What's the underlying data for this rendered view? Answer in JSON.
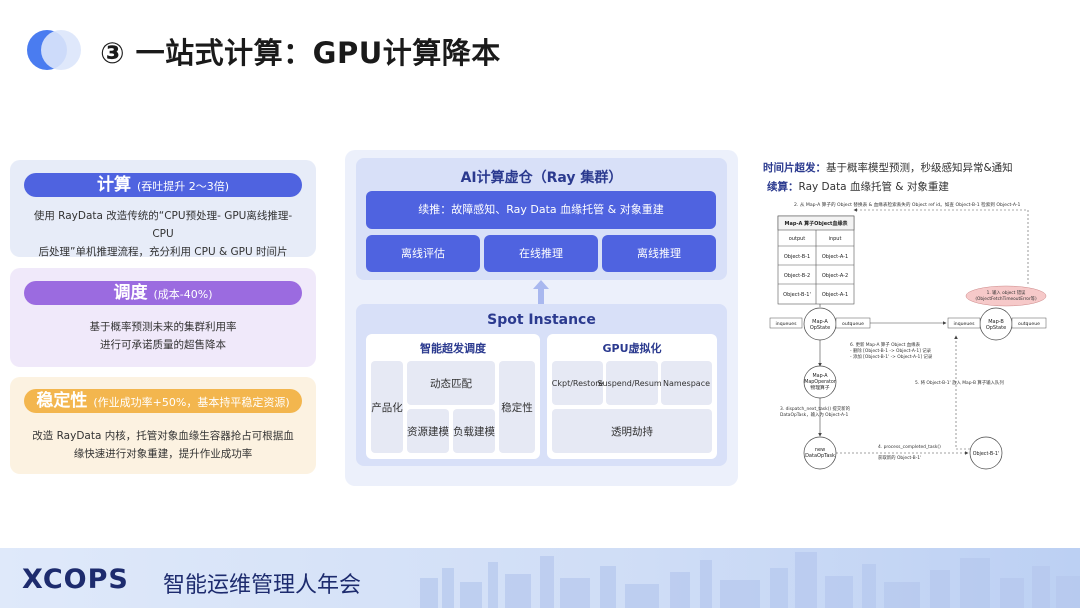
{
  "title": "③ 一站式计算：GPU计算降本",
  "left_cards": {
    "calc": {
      "title": "计算",
      "subtitle": "(吞吐提升 2～3倍)",
      "desc_line1": "使用 RayData 改造传统的“CPU预处理- GPU离线推理-CPU",
      "desc_line2": "后处理”单机推理流程，充分利用 CPU & GPU 时间片"
    },
    "sched": {
      "title": "调度",
      "subtitle": "(成本-40%)",
      "desc_line1": "基于概率预测未来的集群利用率",
      "desc_line2": "进行可承诺质量的超售降本"
    },
    "stab": {
      "title": "稳定性",
      "subtitle": "(作业成功率+50%，基本持平稳定资源)",
      "desc_line1": "改造 RayData 内核，托管对象血缘生容器抢占可根据血",
      "desc_line2": "缘快速进行对象重建，提升作业成功率"
    }
  },
  "ai_box": {
    "title": "AI计算虚仓（Ray 集群）",
    "continuation": "续推：故障感知、Ray Data 血缘托管 & 对象重建",
    "subs": [
      "离线评估",
      "在线推理",
      "离线推理"
    ]
  },
  "spot": {
    "title": "Spot Instance",
    "sched_title": "智能超发调度",
    "productize": "产品化",
    "dynamic_match": "动态匹配",
    "stability": "稳定性",
    "resource_model": "资源建模",
    "load_model": "负载建模",
    "gpu_title": "GPU虚拟化",
    "ckpt": "Ckpt/Restore",
    "suspend": "Suspend/Resume",
    "namespace": "Namespace",
    "transparent": "透明劫持"
  },
  "right": {
    "line1_label": "时间片超发：",
    "line1_text": "基于概率模型预测，秒级感知异常&通知",
    "line2_label": "续算：",
    "line2_text": "Ray Data 血缘托管 & 对象重建",
    "diagram": {
      "step2": "2. 从 Map-A 算子的 Object 替换表 & 血缘表检索丢失的 Object ref id。如查 Object-B-1 检索到 Object-A-1",
      "table_title": "Map-A 算子Object血缘表",
      "col_output": "output",
      "col_input": "input",
      "rows": [
        [
          "Object-B-1",
          "Object-A-1"
        ],
        [
          "Object-B-2",
          "Object-A-2"
        ],
        [
          "Object-B-1'",
          "Object-A-1"
        ]
      ],
      "step1_a": "1. 输入 object 错误",
      "step1_b": "(ObjectFetchTimeoutError等)",
      "mapA_state_1": "Map-A",
      "mapA_state_2": "OpState",
      "mapB_state_1": "Map-B",
      "mapB_state_2": "OpState",
      "inqueues": "inqueues",
      "outqueue": "outqueue",
      "step6_1": "6. 更新 Map-A 算子 Object 血缘表",
      "step6_2": "- 删除 [Object-B-1 -> Object-A-1] 记录",
      "step6_3": "- 添加 [Object-B-1' -> Object-A-1] 记录",
      "mapop_1": "Map-A",
      "mapop_2": "MapOperator",
      "mapop_3": "物理算子",
      "step5": "5. 将 Object-B-1' 放入 Map-B 算子输入队列",
      "step3_1": "3. dispatch_next_task() 提交新的",
      "step3_2": "DataOpTask，输入为 Object-A-1",
      "new_1": "new",
      "new_2": "DataOpTask",
      "step4_1": "4. process_completed_task()",
      "step4_2": "获取新的 Object-B-1'",
      "objB": "Object-B-1'"
    }
  },
  "footer": {
    "brand": "XCOPS",
    "brand_cn": "智能运维管理人年会"
  }
}
